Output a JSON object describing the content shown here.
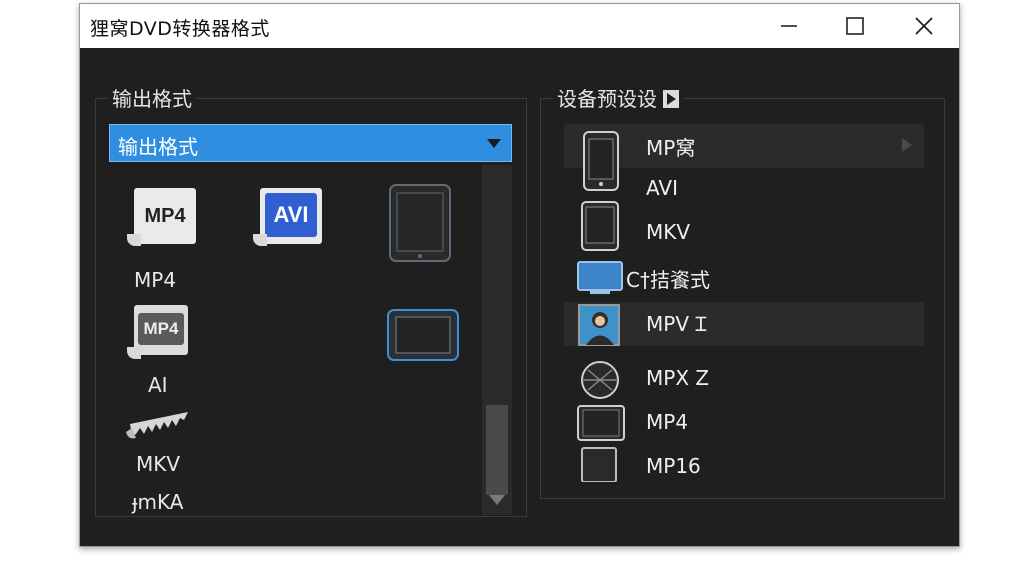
{
  "window": {
    "title": "狸窝DVD转换器格式",
    "min_glyph": "—",
    "close_glyph": "✕"
  },
  "output_format": {
    "group_label": "输出格式",
    "dropdown_value": "输出格式",
    "items": [
      {
        "badge": "MP4",
        "label": "MP4",
        "icon": "mp4-file-icon"
      },
      {
        "badge": "AVI",
        "label": "",
        "icon": "avi-file-icon"
      },
      {
        "badge": "",
        "label": "",
        "icon": "tablet-icon"
      },
      {
        "badge": "MP4",
        "label": "AI",
        "icon": "mp4-small-file-icon"
      },
      {
        "badge": "",
        "label": "",
        "icon": "tablet-landscape-icon"
      },
      {
        "badge": "",
        "label": "MKV",
        "icon": "mkv-file-icon"
      },
      {
        "badge": "",
        "label": "ɟmKA",
        "icon": ""
      }
    ]
  },
  "device_presets": {
    "group_label": "设备预设设",
    "items": [
      {
        "label": "MP窝",
        "icon": "phone-icon",
        "highlight": true
      },
      {
        "label": "AVI",
        "icon": "",
        "highlight": false
      },
      {
        "label": "MKV",
        "icon": "tablet-icon",
        "highlight": false
      },
      {
        "label": "C†拮餈式",
        "icon": "monitor-icon",
        "highlight": false
      },
      {
        "label": "MPV Ɪ",
        "icon": "person-photo-icon",
        "highlight": true
      },
      {
        "label": "MPX Z",
        "icon": "globe-icon",
        "highlight": false
      },
      {
        "label": "MP4",
        "icon": "tablet-landscape-icon",
        "highlight": false
      },
      {
        "label": "MP16",
        "icon": "device-icon",
        "highlight": false
      }
    ]
  },
  "colors": {
    "accent": "#2f8ee0",
    "panel": "#1f1f1f",
    "avi_blue": "#2f5fd0"
  }
}
